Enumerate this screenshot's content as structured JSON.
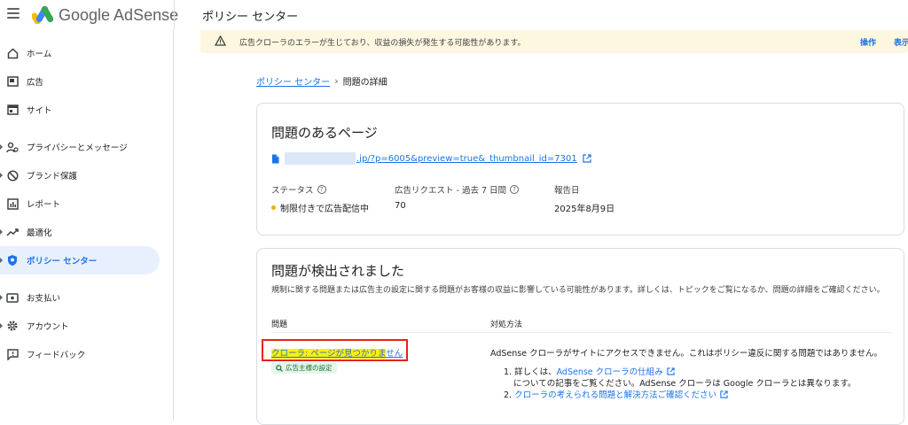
{
  "app": {
    "brand": "Google AdSense",
    "page_title": "ポリシー センター"
  },
  "sidebar": {
    "items": [
      {
        "label": "ホーム",
        "icon": "home-icon"
      },
      {
        "label": "広告",
        "icon": "ads-icon"
      },
      {
        "label": "サイト",
        "icon": "sites-icon"
      },
      {
        "label": "プライバシーとメッセージ",
        "icon": "privacy-icon"
      },
      {
        "label": "ブランド保護",
        "icon": "block-icon"
      },
      {
        "label": "レポート",
        "icon": "report-icon"
      },
      {
        "label": "最適化",
        "icon": "trending-icon"
      },
      {
        "label": "ポリシー センター",
        "icon": "shield-icon"
      },
      {
        "label": "お支払い",
        "icon": "payment-icon"
      },
      {
        "label": "アカウント",
        "icon": "gear-icon"
      },
      {
        "label": "フィードバック",
        "icon": "feedback-icon"
      }
    ]
  },
  "alert": {
    "text": "広告クローラのエラーが生じており、収益の損失が発生する可能性があります。",
    "action_label": "操作",
    "show_label": "表示",
    "icon": "warning-icon"
  },
  "breadcrumb": {
    "parent": "ポリシー センター",
    "current": "問題の詳細"
  },
  "page_card": {
    "title": "問題のあるページ",
    "url_visible": ".jp/?p=6005&preview=true&_thumbnail_id=7301",
    "stats": {
      "status_label": "ステータス",
      "status_value": "制限付きで広告配信中",
      "requests_label": "広告リクエスト - 過去 7 日間",
      "requests_value": "70",
      "date_label": "報告日",
      "date_value": "2025年8月9日"
    }
  },
  "issues_card": {
    "title": "問題が検出されました",
    "description": "規制に関する問題または広告主の設定に関する問題がお客様の収益に影響している可能性があります。詳しくは、トピックをご覧になるか、問題の詳細をご確認ください。",
    "col_issue": "問題",
    "col_action": "対処方法",
    "issue": {
      "link_highlighted": "クローラ: ページが見つかりま",
      "link_rest": "せん",
      "tag": "広告主様の設定"
    },
    "action": {
      "summary": "AdSense クローラがサイトにアクセスできません。これはポリシー違反に関する問題ではありません。",
      "item1_prefix": "1. 詳しくは、",
      "item1_link": "AdSense クローラの仕組み",
      "item1_suffix": "についての記事をご覧ください。AdSense クローラは Google クローラとは異なります。",
      "item2_prefix": "2. ",
      "item2_link": "クローラの考えられる問題と解決方法ご確認ください"
    }
  },
  "colors": {
    "accent": "#1a73e8",
    "warning_bg": "#fef7e0",
    "status_dot": "#f9ab00",
    "highlight": "#fff200",
    "annotation_box": "#e3241b"
  }
}
